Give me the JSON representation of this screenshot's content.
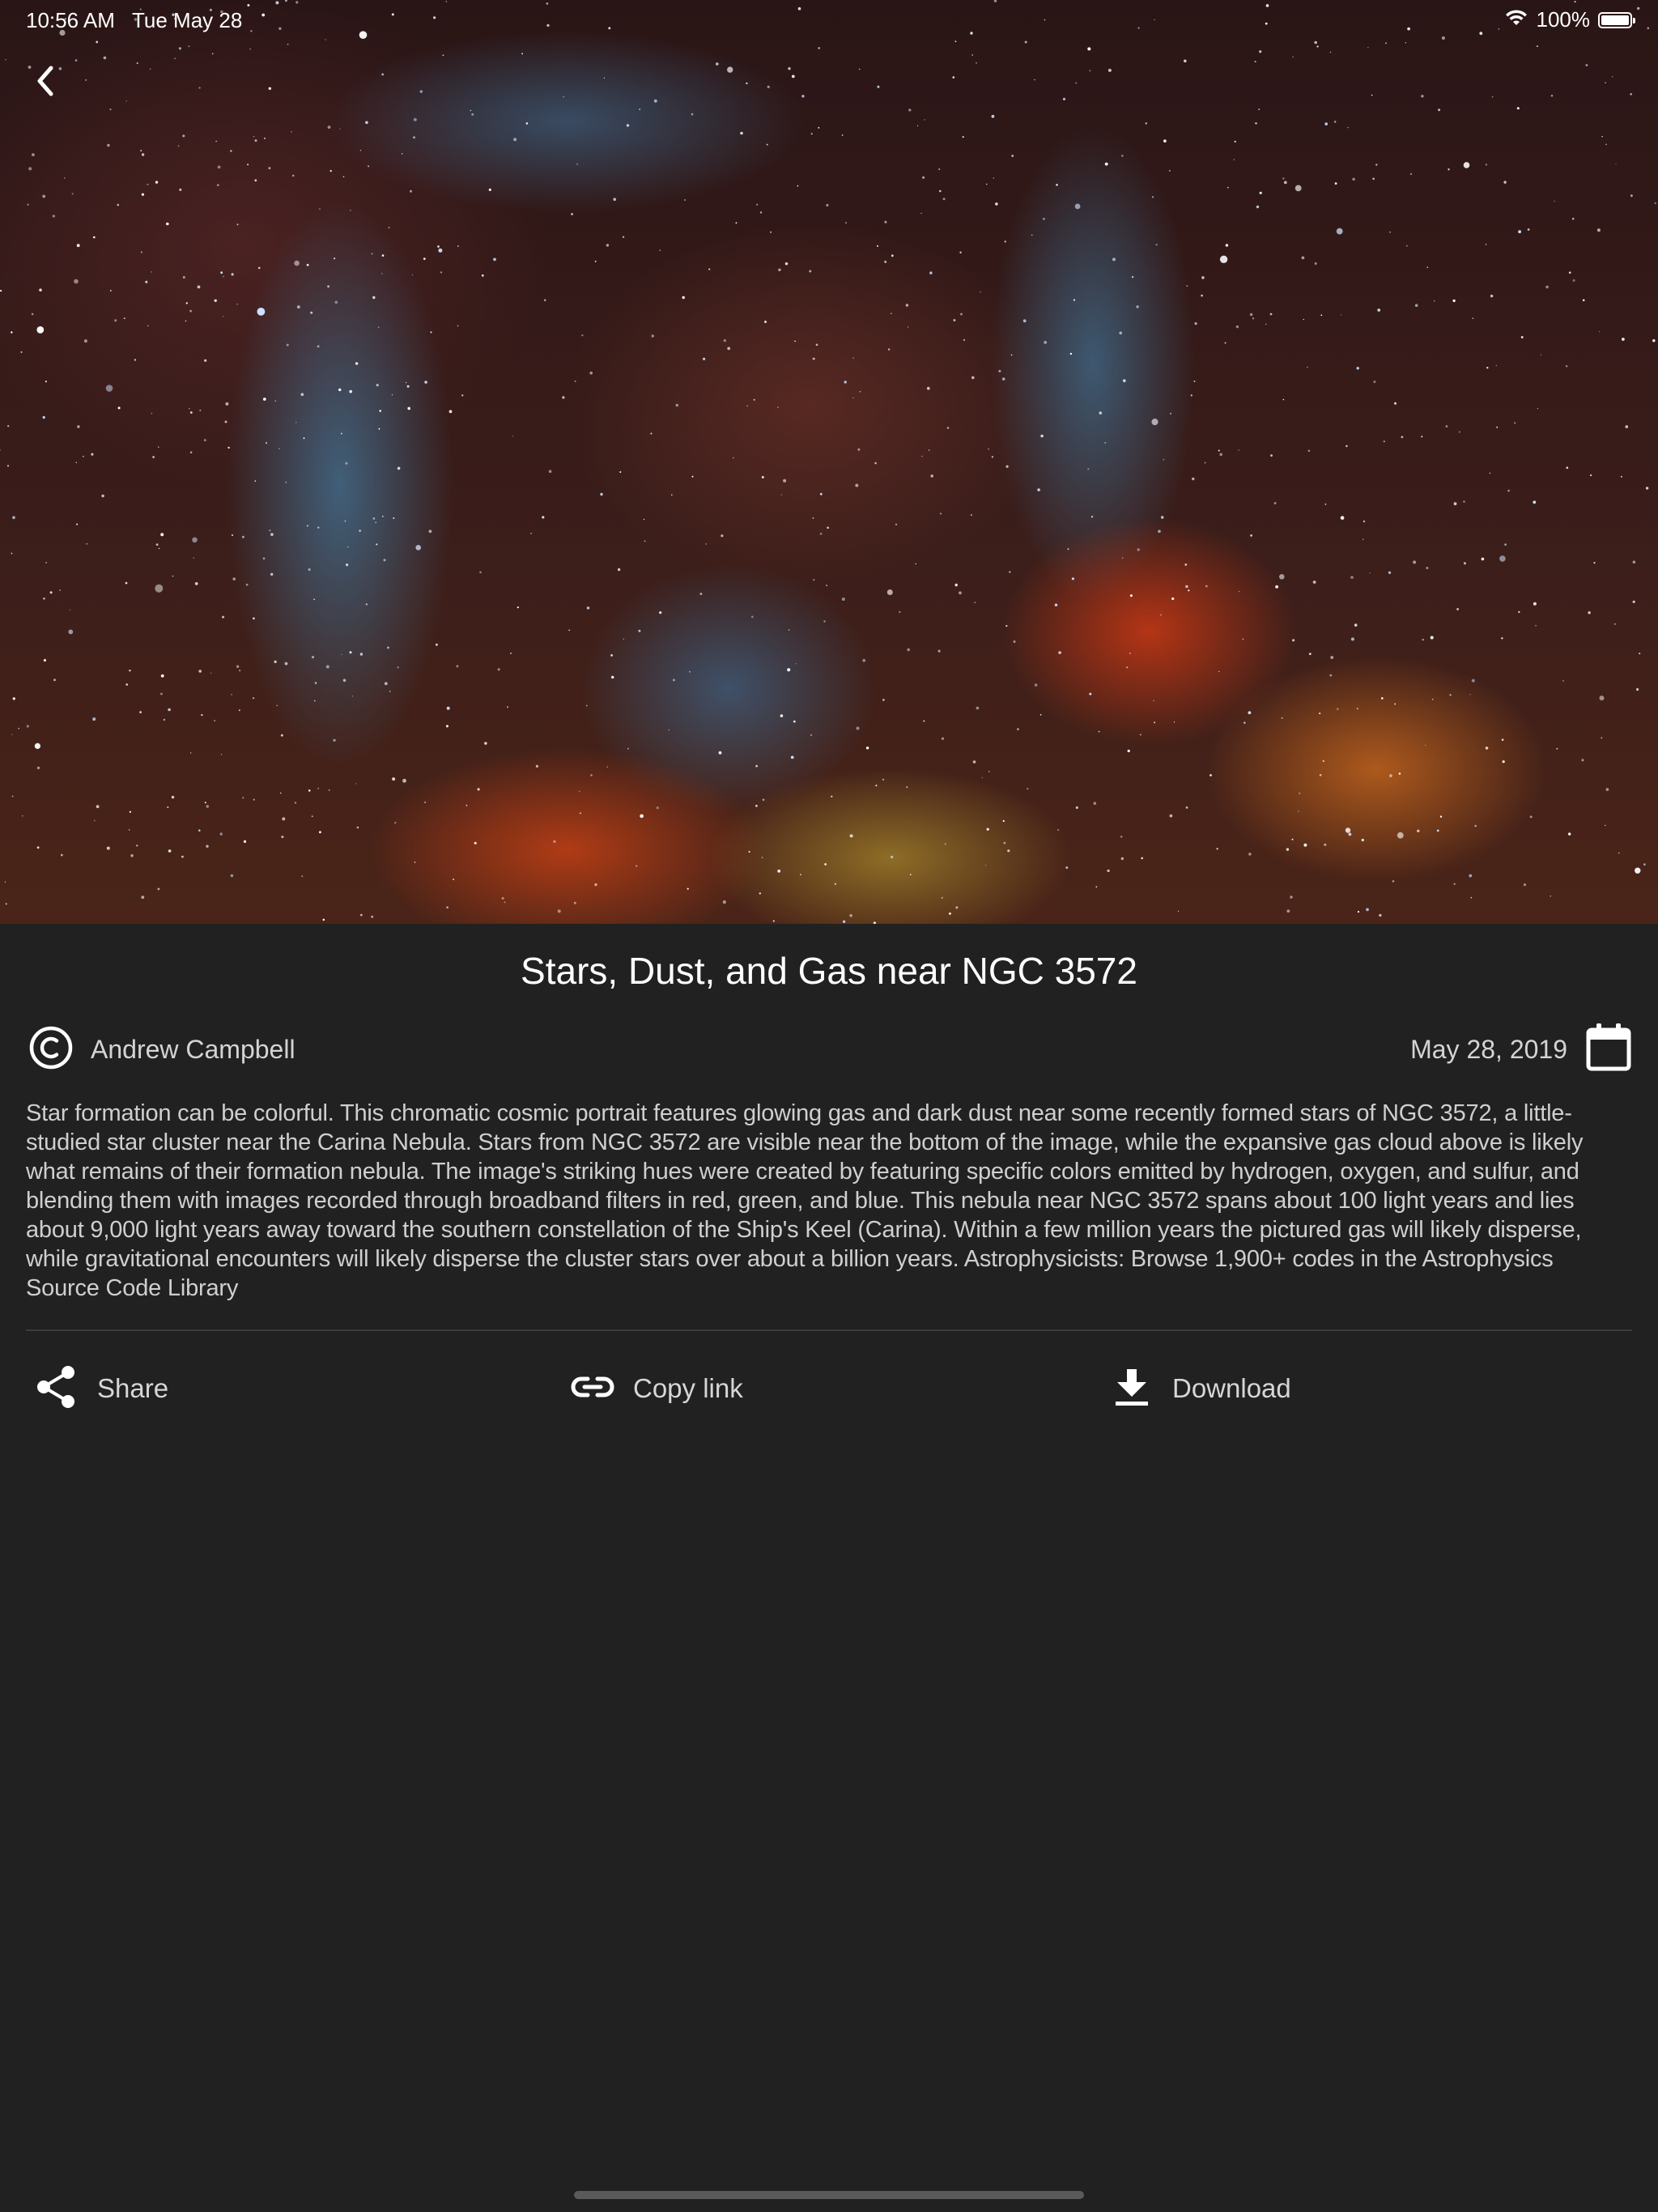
{
  "status_bar": {
    "time": "10:56 AM",
    "date": "Tue May 28",
    "battery": "100%",
    "icons": [
      "wifi-icon",
      "battery-icon"
    ]
  },
  "navigation": {
    "back_icon": "chevron-left-icon"
  },
  "article": {
    "title": "Stars, Dust, and Gas near NGC 3572",
    "author": "Andrew Campbell",
    "date": "May 28, 2019",
    "description": "Star formation can be colorful.  This chromatic cosmic portrait features glowing gas and dark dust near some recently formed stars of NGC 3572, a little-studied star cluster near the Carina Nebula.  Stars from NGC 3572 are visible near the bottom of the image, while the expansive gas cloud above is likely what remains of their formation nebula. The image's striking hues were created by featuring specific colors emitted by hydrogen, oxygen, and sulfur, and blending them with images recorded through broadband filters in red, green, and blue. This nebula near NGC 3572 spans about 100 light years and lies about 9,000 light years away toward the southern constellation of the Ship's Keel (Carina).  Within a few million years the pictured gas will likely disperse, while gravitational encounters will likely disperse the cluster stars over about a billion years.   Astrophysicists: Browse 1,900+ codes in the Astrophysics Source Code Library"
  },
  "actions": {
    "share_label": "Share",
    "copy_link_label": "Copy link",
    "download_label": "Download"
  },
  "colors": {
    "background": "#212121",
    "text_primary": "#ffffff",
    "text_secondary": "#d4d4d4",
    "divider": "#3c3c3c"
  }
}
